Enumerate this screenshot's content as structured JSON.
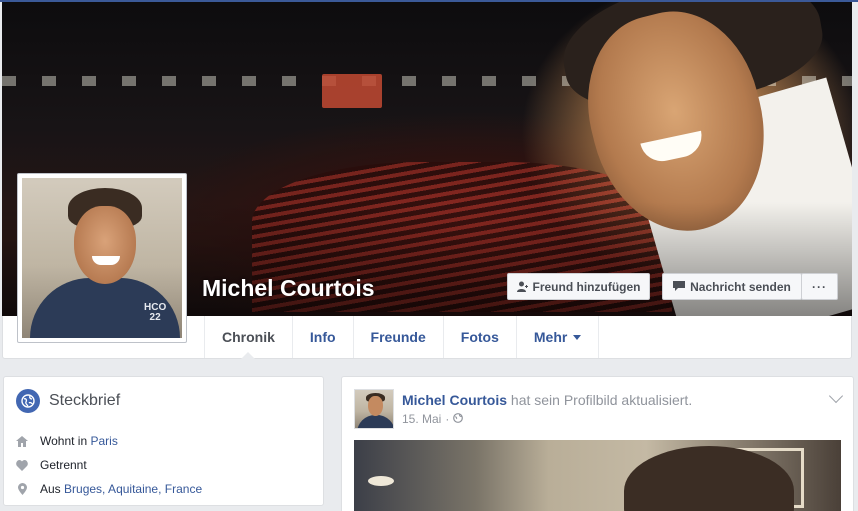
{
  "profile": {
    "name": "Michel Courtois",
    "actions": {
      "add_friend": "Freund hinzufügen",
      "send_message": "Nachricht senden",
      "more": "···"
    }
  },
  "tabs": [
    {
      "label": "Chronik",
      "active": true
    },
    {
      "label": "Info"
    },
    {
      "label": "Freunde"
    },
    {
      "label": "Fotos"
    },
    {
      "label": "Mehr"
    }
  ],
  "intro": {
    "title": "Steckbrief",
    "lives_prefix": "Wohnt in",
    "lives_city": "Paris",
    "relationship": "Getrennt",
    "from_prefix": "Aus",
    "from_place": "Bruges, Aquitaine, France"
  },
  "post": {
    "author": "Michel Courtois",
    "action": "hat sein Profilbild aktualisiert.",
    "date": "15. Mai",
    "separator": "·"
  },
  "colors": {
    "link": "#365899",
    "brand": "#3b5998",
    "background": "#e9ebee"
  }
}
